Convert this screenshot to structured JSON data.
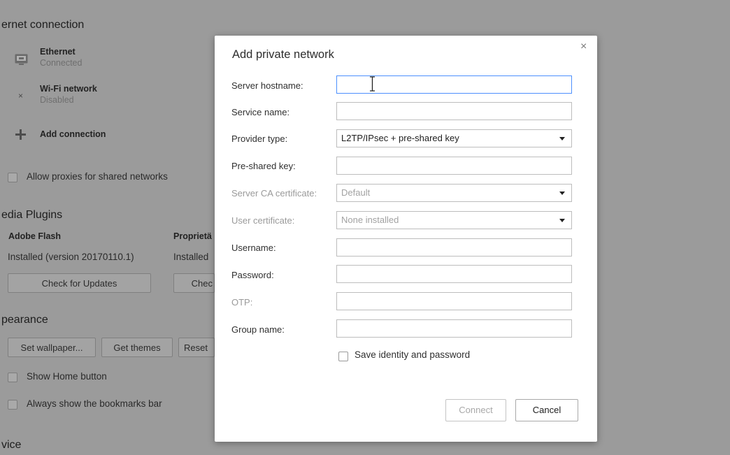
{
  "background": {
    "internet_title": "ernet connection",
    "ethernet": {
      "name": "Ethernet",
      "status": "Connected"
    },
    "wifi": {
      "name": "Wi-Fi network",
      "status": "Disabled"
    },
    "add_connection": "Add connection",
    "allow_proxies": "Allow proxies for shared networks",
    "media_title": "edia Plugins",
    "flash": {
      "name": "Adobe Flash",
      "status": "Installed (version 20170110.1)",
      "button": "Check for Updates"
    },
    "proprietary": {
      "name": "Proprietä",
      "status": "Installed",
      "button": "Chec"
    },
    "appearance_title": "pearance",
    "set_wallpaper": "Set wallpaper...",
    "get_themes": "Get themes",
    "reset": "Reset",
    "show_home": "Show Home button",
    "always_bookmarks": "Always show the bookmarks bar",
    "device_title": "vice"
  },
  "dialog": {
    "title": "Add private network",
    "close_symbol": "×",
    "fields": {
      "server_hostname": {
        "label": "Server hostname:",
        "value": ""
      },
      "service_name": {
        "label": "Service name:",
        "value": ""
      },
      "provider_type": {
        "label": "Provider type:",
        "value": "L2TP/IPsec + pre-shared key"
      },
      "pre_shared_key": {
        "label": "Pre-shared key:",
        "value": ""
      },
      "server_ca": {
        "label": "Server CA certificate:",
        "value": "Default"
      },
      "user_cert": {
        "label": "User certificate:",
        "value": "None installed"
      },
      "username": {
        "label": "Username:",
        "value": ""
      },
      "password": {
        "label": "Password:",
        "value": ""
      },
      "otp": {
        "label": "OTP:",
        "value": ""
      },
      "group_name": {
        "label": "Group name:",
        "value": ""
      }
    },
    "save_identity": "Save identity and password",
    "connect": "Connect",
    "cancel": "Cancel"
  }
}
